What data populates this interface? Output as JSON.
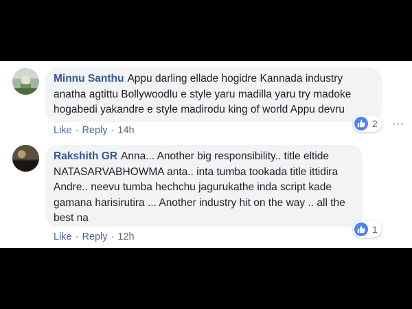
{
  "comments": [
    {
      "author": "Minnu Santhu",
      "text": "Appu darling ellade hogidre Kannada industry anatha agtittu Bollywoodlu e style yaru madilla yaru try madoke hogabedi yakandre e style madirodu king of world Appu devru",
      "like_label": "Like",
      "reply_label": "Reply",
      "time": "14h",
      "reaction_count": "2",
      "reaction_icon": "thumbs-up-icon"
    },
    {
      "author": "Rakshith GR",
      "text": "Anna... Another big responsibility.. title eltide NATASARVABHOWMA anta.. inta tumba tookada title ittidira Andre.. neevu tumba hechchu jagurukathe inda script kade gamana harisirutira ... Another industry hit on the way .. all the best na",
      "like_label": "Like",
      "reply_label": "Reply",
      "time": "12h",
      "reaction_count": "1",
      "reaction_icon": "thumbs-up-icon"
    }
  ],
  "separator": "·",
  "colors": {
    "author": "#365899",
    "link": "#4b67a1",
    "bubble": "#f2f3f5",
    "like_blue": "#4a82f7"
  }
}
